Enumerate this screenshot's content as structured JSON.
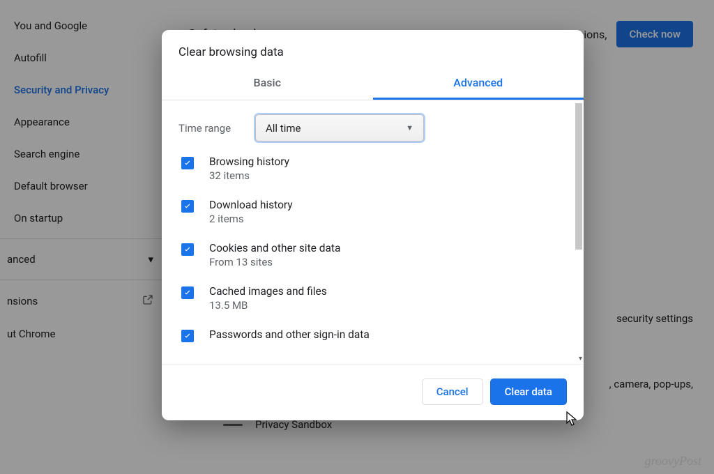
{
  "sidebar": {
    "items": [
      {
        "label": "You and Google"
      },
      {
        "label": "Autofill"
      },
      {
        "label": "Security and Privacy",
        "selected": true
      },
      {
        "label": "Appearance"
      },
      {
        "label": "Search engine"
      },
      {
        "label": "Default browser"
      },
      {
        "label": "On startup"
      }
    ],
    "advanced_label": "anced",
    "links": [
      {
        "label": "nsions"
      },
      {
        "label": "ut Chrome"
      }
    ]
  },
  "background": {
    "safety_fragment": "Safety check",
    "extensions_fragment": "xtensions,",
    "check_now_label": "Check now",
    "security_fragment": "security settings",
    "camera_fragment": ", camera, pop-ups,",
    "privacy_sandbox": "Privacy Sandbox"
  },
  "dialog": {
    "title": "Clear browsing data",
    "tabs": {
      "basic": "Basic",
      "advanced": "Advanced"
    },
    "time_range": {
      "label": "Time range",
      "value": "All time"
    },
    "options": [
      {
        "title": "Browsing history",
        "subtitle": "32 items"
      },
      {
        "title": "Download history",
        "subtitle": "2 items"
      },
      {
        "title": "Cookies and other site data",
        "subtitle": "From 13 sites"
      },
      {
        "title": "Cached images and files",
        "subtitle": "13.5 MB"
      },
      {
        "title": "Passwords and other sign-in data",
        "subtitle": ""
      }
    ],
    "cancel_label": "Cancel",
    "clear_label": "Clear data"
  },
  "watermark": "groovyPost"
}
